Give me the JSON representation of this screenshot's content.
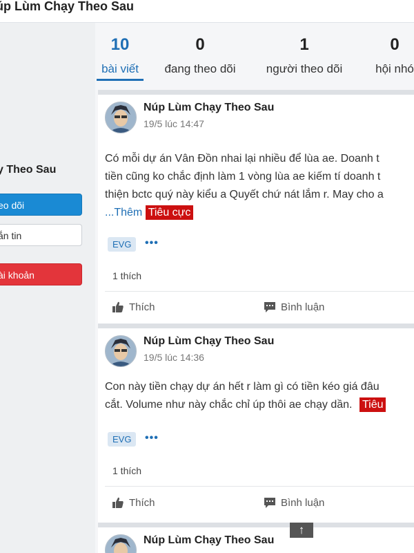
{
  "header": {
    "title": "úp Lùm Chạy Theo Sau"
  },
  "profile": {
    "name": "y Theo Sau",
    "follow_label": "eo dõi",
    "message_label": "ắn tin",
    "account_label": "ài khoản"
  },
  "stats": [
    {
      "num": "10",
      "label": "bài viết"
    },
    {
      "num": "0",
      "label": "đang theo dõi"
    },
    {
      "num": "1",
      "label": "người theo dõi"
    },
    {
      "num": "0",
      "label": "hội nhó"
    }
  ],
  "posts": [
    {
      "author": "Núp Lùm Chạy Theo Sau",
      "time": "19/5 lúc 14:47",
      "lines": [
        "Có mỗi dự án Vân Đồn nhai lại nhiều để lùa ae. Doanh t",
        "tiền cũng ko chắc định làm 1 vòng lùa ae kiếm tí doanh t",
        "thiện bctc quý này kiểu a Quyết chứ nát lắm r. May cho a"
      ],
      "more": "...Thêm",
      "sentiment": "Tiêu cực",
      "tag": "EVG",
      "tag_more": "•••",
      "likes": "1 thích",
      "like_label": "Thích",
      "comment_label": "Bình luận"
    },
    {
      "author": "Núp Lùm Chạy Theo Sau",
      "time": "19/5 lúc 14:36",
      "lines": [
        "Con này tiền chạy dự án hết r làm gì có tiền kéo giá đâu",
        "cắt. Volume như này chắc chỉ úp thôi ae chạy dần."
      ],
      "sentiment": "Tiêu",
      "tag": "EVG",
      "tag_more": "•••",
      "likes": "1 thích",
      "like_label": "Thích",
      "comment_label": "Bình luận"
    },
    {
      "author": "Núp Lùm Chạy Theo Sau"
    }
  ],
  "scroll_top_label": "↑"
}
